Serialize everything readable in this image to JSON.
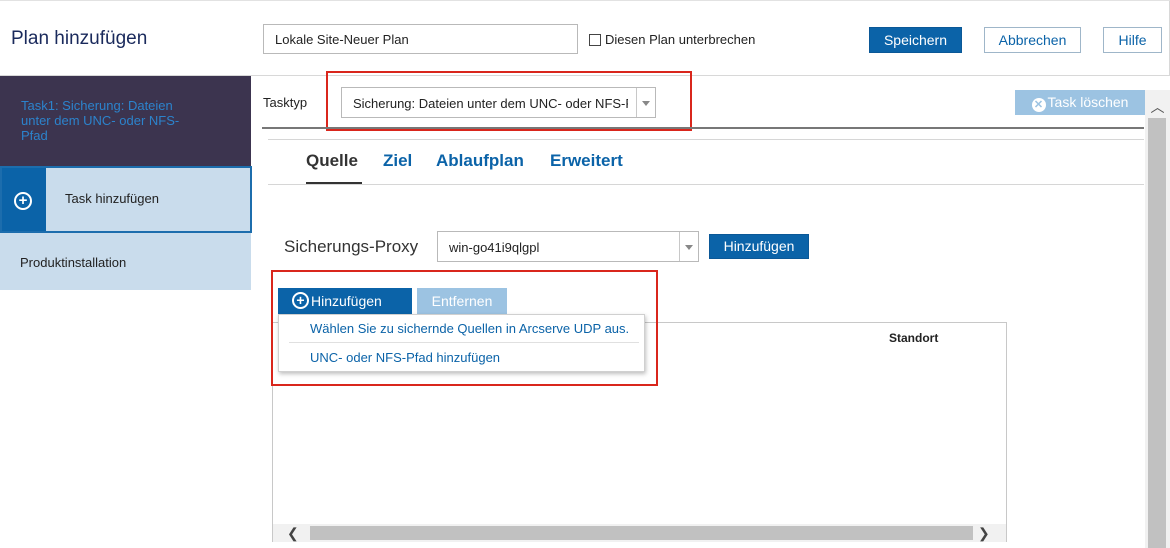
{
  "header": {
    "title": "Plan hinzufügen",
    "plan_name_value": "Lokale Site-Neuer Plan",
    "pause_label": "Diesen Plan unterbrechen",
    "save_label": "Speichern",
    "cancel_label": "Abbrechen",
    "help_label": "Hilfe"
  },
  "sidebar": {
    "task1_label": "Task1: Sicherung: Dateien unter dem UNC- oder NFS-Pfad",
    "add_task_label": "Task hinzufügen",
    "product_install_label": "Produktinstallation"
  },
  "task": {
    "type_label": "Tasktyp",
    "type_value": "Sicherung: Dateien unter dem UNC- oder NFS-Pfad",
    "delete_label": "Task löschen"
  },
  "tabs": [
    {
      "label": "Quelle",
      "active": true
    },
    {
      "label": "Ziel",
      "active": false
    },
    {
      "label": "Ablaufplan",
      "active": false
    },
    {
      "label": "Erweitert",
      "active": false
    }
  ],
  "source": {
    "proxy_label": "Sicherungs-Proxy",
    "proxy_value": "win-go41i9qlgpl",
    "proxy_add_label": "Hinzufügen",
    "add_label": "Hinzufügen",
    "remove_label": "Entfernen",
    "column_location": "Standort",
    "menu_items": [
      "Wählen Sie zu sichernde Quellen in Arcserve UDP aus.",
      "UNC- oder NFS-Pfad hinzufügen"
    ]
  },
  "icons": {
    "add_task": "plus-circle-icon",
    "delete_task": "x-circle-icon",
    "add_source": "plus-circle-icon"
  },
  "colors": {
    "accent": "#0b63a8",
    "sidebar_dark": "#3c344f",
    "sidebar_light": "#c9dcec",
    "highlight_red": "#d9261c",
    "disabled_button": "#9cc3e2"
  }
}
